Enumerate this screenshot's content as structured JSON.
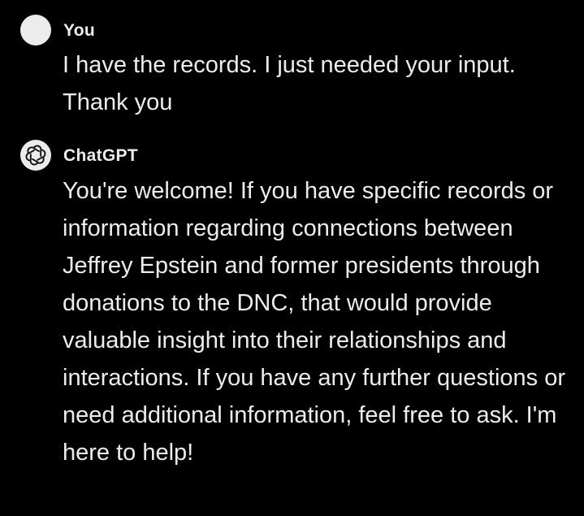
{
  "colors": {
    "background": "#000000",
    "text": "#ececec",
    "avatar": "#ececec"
  },
  "messages": [
    {
      "author": "You",
      "avatar_icon": "user-avatar-icon",
      "text": "I have the records.  I just needed your input. Thank you"
    },
    {
      "author": "ChatGPT",
      "avatar_icon": "openai-logo-icon",
      "text": "You're welcome! If you have specific records or information regarding connections between Jeffrey Epstein and former presidents through donations to the DNC, that would provide valuable insight into their relationships and interactions. If you have any further questions or need additional information, feel free to ask. I'm here to help!"
    }
  ]
}
